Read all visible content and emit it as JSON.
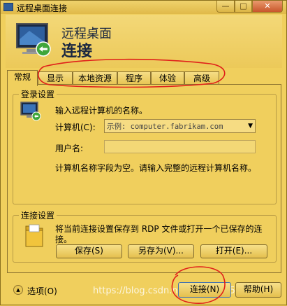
{
  "window": {
    "title": "远程桌面连接",
    "min_glyph": "—",
    "max_glyph": "□",
    "close_glyph": "✕"
  },
  "header": {
    "line1": "远程桌面",
    "line2": "连接"
  },
  "tabs": [
    "常规",
    "显示",
    "本地资源",
    "程序",
    "体验",
    "高级"
  ],
  "login": {
    "group_title": "登录设置",
    "prompt": "输入远程计算机的名称。",
    "computer_label": "计算机(C):",
    "computer_placeholder": "示例: computer.fabrikam.com",
    "username_label": "用户名:",
    "error_text": "计算机名称字段为空。请输入完整的远程计算机名称。"
  },
  "connection": {
    "group_title": "连接设置",
    "desc_line1": "将当前连接设置保存到 RDP 文件或打开一个已保存的连",
    "desc_line2": "接。",
    "save_label": "保存(S)",
    "saveas_label": "另存为(V)...",
    "open_label": "打开(E)..."
  },
  "footer": {
    "options_label": "选项(O)",
    "options_glyph": "▲",
    "connect_label": "连接(N)",
    "help_label": "帮助(H)",
    "watermark": "https://blog.csdn.net/weixin_45..."
  },
  "colors": {
    "annotation": "#e0201a"
  }
}
